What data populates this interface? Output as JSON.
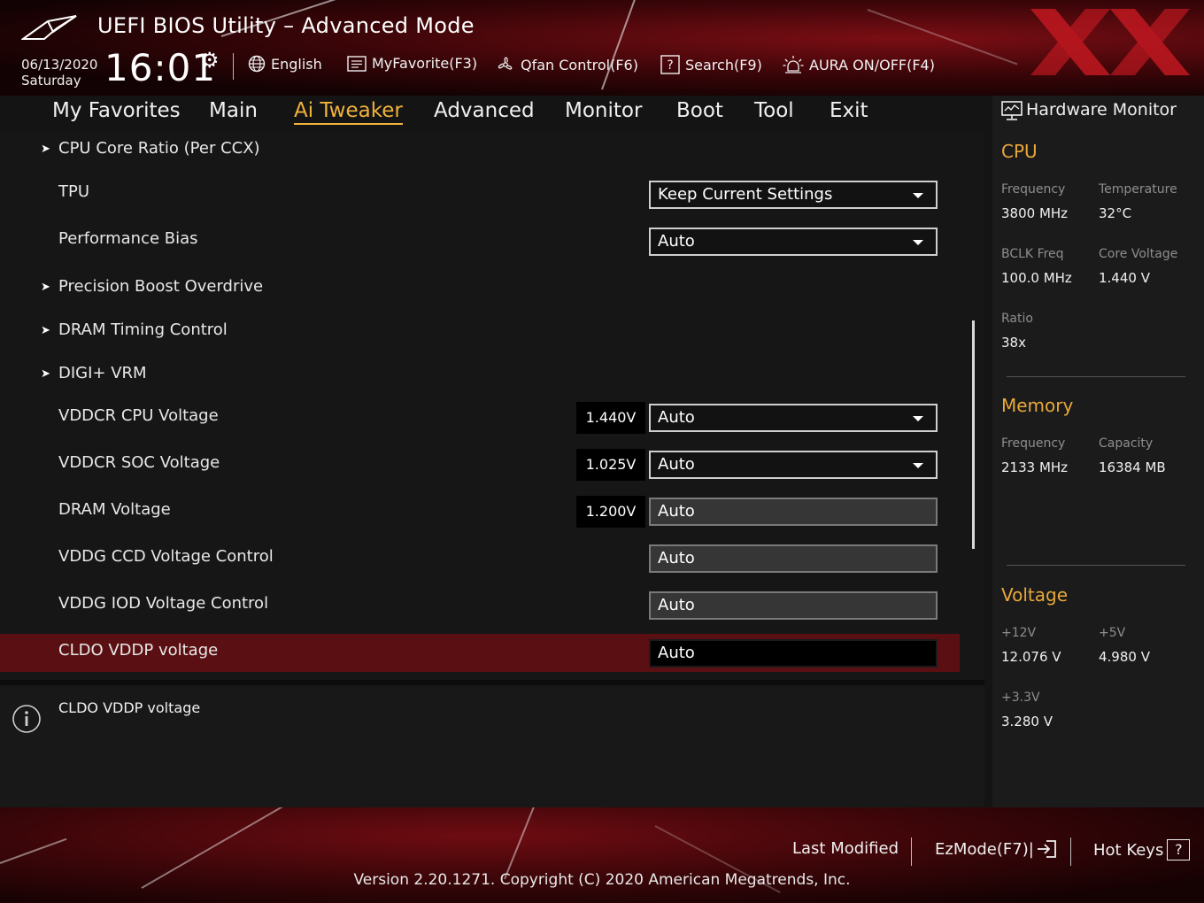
{
  "header": {
    "title": "UEFI BIOS Utility – Advanced Mode",
    "date": "06/13/2020",
    "day": "Saturday",
    "time": "16:01",
    "toolbar": {
      "language": "English",
      "myfavorite": "MyFavorite(F3)",
      "qfan": "Qfan Control(F6)",
      "search": "Search(F9)",
      "aura": "AURA ON/OFF(F4)"
    }
  },
  "menu": {
    "items": [
      "My Favorites",
      "Main",
      "Ai Tweaker",
      "Advanced",
      "Monitor",
      "Boot",
      "Tool",
      "Exit"
    ],
    "active": "Ai Tweaker"
  },
  "settings": [
    {
      "label": "CPU Core Ratio (Per CCX)",
      "submenu": true
    },
    {
      "label": "TPU",
      "value": "Keep Current Settings",
      "control": "dropdown"
    },
    {
      "label": "Performance Bias",
      "value": "Auto",
      "control": "dropdown"
    },
    {
      "label": "Precision Boost Overdrive",
      "submenu": true
    },
    {
      "label": "DRAM Timing Control",
      "submenu": true
    },
    {
      "label": "DIGI+ VRM",
      "submenu": true
    },
    {
      "label": "VDDCR CPU Voltage",
      "reading": "1.440V",
      "value": "Auto",
      "control": "dropdown"
    },
    {
      "label": "VDDCR SOC Voltage",
      "reading": "1.025V",
      "value": "Auto",
      "control": "dropdown"
    },
    {
      "label": "DRAM Voltage",
      "reading": "1.200V",
      "value": "Auto",
      "control": "field"
    },
    {
      "label": "VDDG CCD Voltage Control",
      "value": "Auto",
      "control": "field"
    },
    {
      "label": "VDDG IOD Voltage Control",
      "value": "Auto",
      "control": "field"
    },
    {
      "label": "CLDO VDDP voltage",
      "value": "Auto",
      "control": "field",
      "selected": true
    }
  ],
  "help": {
    "text": "CLDO VDDP voltage"
  },
  "hardware_monitor": {
    "title": "Hardware Monitor",
    "cpu": {
      "title": "CPU",
      "frequency_label": "Frequency",
      "frequency": "3800 MHz",
      "temperature_label": "Temperature",
      "temperature": "32°C",
      "bclk_label": "BCLK Freq",
      "bclk": "100.0 MHz",
      "core_voltage_label": "Core Voltage",
      "core_voltage": "1.440 V",
      "ratio_label": "Ratio",
      "ratio": "38x"
    },
    "memory": {
      "title": "Memory",
      "frequency_label": "Frequency",
      "frequency": "2133 MHz",
      "capacity_label": "Capacity",
      "capacity": "16384 MB"
    },
    "voltage": {
      "title": "Voltage",
      "v12_label": "+12V",
      "v12": "12.076 V",
      "v5_label": "+5V",
      "v5": "4.980 V",
      "v33_label": "+3.3V",
      "v33": "3.280 V"
    }
  },
  "footer": {
    "last_modified": "Last Modified",
    "ezmode": "EzMode(F7)|",
    "hotkeys": "Hot Keys",
    "hotkeys_badge": "?",
    "version": "Version 2.20.1271. Copyright (C) 2020 American Megatrends, Inc."
  },
  "colors": {
    "accent": "#f0b23c",
    "selected_row": "#5a1012",
    "background": "#141414"
  }
}
